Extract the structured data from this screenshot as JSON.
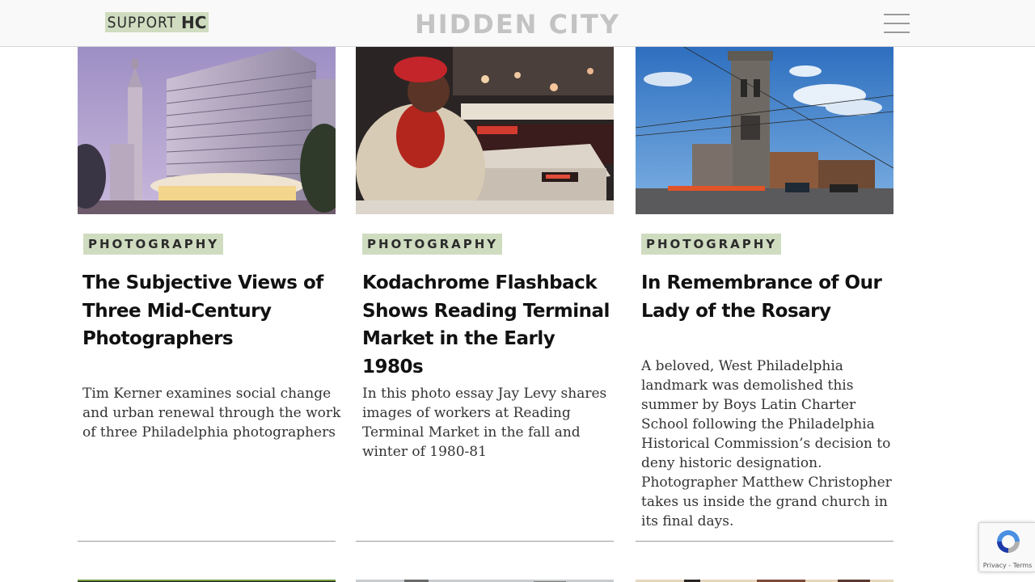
{
  "header": {
    "support_prefix": "SUPPORT",
    "support_suffix": "HC",
    "logo": "HIDDEN CITY",
    "menu_icon": "hamburger-menu-icon"
  },
  "colors": {
    "tag_bg": "#cfdcc0",
    "header_bg": "#f9f9f9",
    "logo_text": "#c3c3c3"
  },
  "articles": [
    {
      "tag": "PHOTOGRAPHY",
      "title_lines": [
        "The Subjective Views of",
        "Three Mid-Century",
        "Photographers"
      ],
      "excerpt_lines": [
        "Tim Kerner examines social change",
        "and urban renewal through the work",
        "of three Philadelphia photographers"
      ]
    },
    {
      "tag": "PHOTOGRAPHY",
      "title_lines": [
        "Kodachrome Flashback",
        "Shows Reading Terminal",
        "Market in the Early 1980s"
      ],
      "excerpt_lines": [
        "In this photo essay Jay Levy shares",
        "images of workers at Reading",
        "Terminal Market in the fall and",
        "winter of 1980-81"
      ]
    },
    {
      "tag": "PHOTOGRAPHY",
      "title_lines": [
        "In Remembrance of Our",
        "Lady of the Rosary"
      ],
      "excerpt_lines": [
        "A beloved, West Philadelphia",
        "landmark was demolished this",
        "summer by Boys Latin Charter",
        "School following the Philadelphia",
        "Historical Commission’s decision to",
        "deny historic designation.",
        "Photographer Matthew Christopher",
        "takes us inside the grand church in",
        "its final days."
      ]
    }
  ],
  "recaptcha": {
    "links": "Privacy - Terms"
  }
}
